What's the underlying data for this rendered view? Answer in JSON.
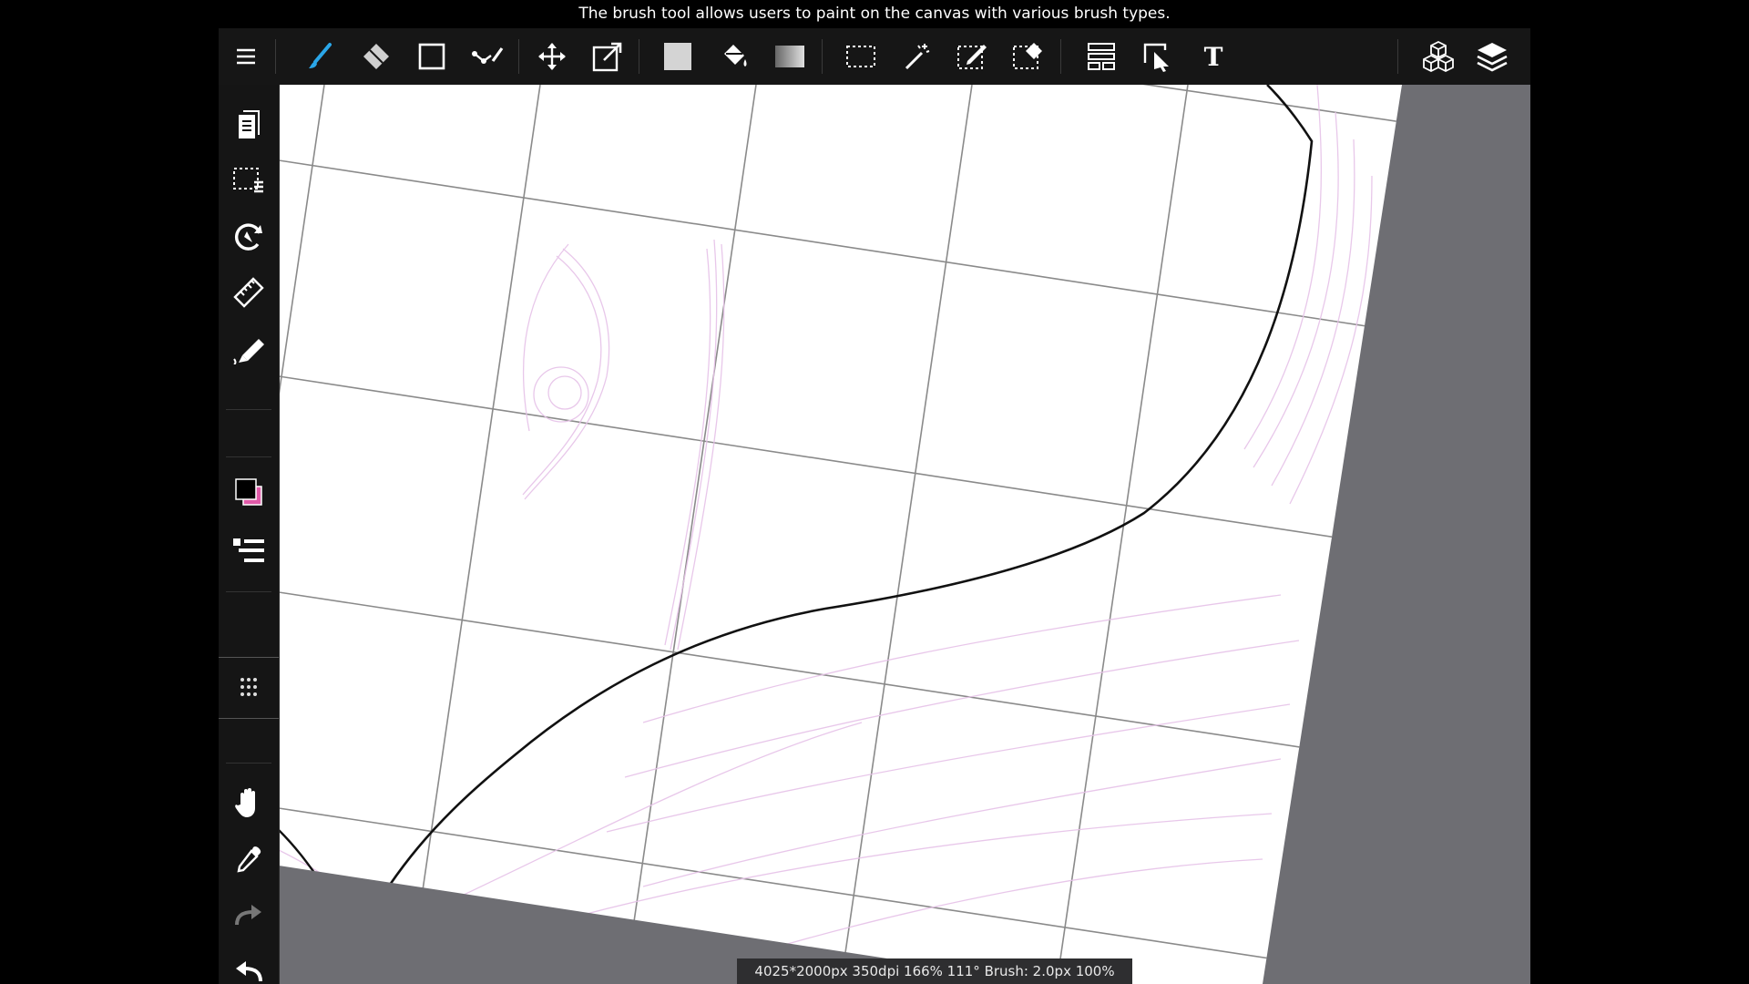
{
  "caption": "The brush tool allows users to paint on the canvas with various brush types.",
  "status_text": "4025*2000px 350dpi 166% 111° Brush: 2.0px 100%",
  "colors": {
    "accent": "#2aa6e8",
    "main_color": "#000000",
    "sub_color": "#e05aa8",
    "canvas_bg": "#6e6e73",
    "toolbar_bg": "#161616"
  },
  "toolbar": {
    "menu": "menu-icon",
    "tools": [
      "brush-icon",
      "eraser-icon",
      "shape-icon",
      "line-icon",
      "move-icon",
      "transform-icon",
      "fill-color-icon",
      "bucket-icon",
      "gradient-icon",
      "select-rect-icon",
      "magic-wand-icon",
      "select-pen-icon",
      "select-eraser-icon",
      "layout-icon",
      "select-arrow-icon",
      "text-icon"
    ],
    "right": [
      "3d-material-icon",
      "layers-icon"
    ],
    "active_tool": "brush-icon"
  },
  "sidebar": {
    "items": [
      "pages-icon",
      "selection-menu-icon",
      "rotate-icon",
      "ruler-icon",
      "pen-icon",
      "color-swatch",
      "list-icon",
      "grid-icon",
      "hand-icon",
      "eyedropper-icon",
      "redo-icon",
      "undo-icon"
    ]
  }
}
